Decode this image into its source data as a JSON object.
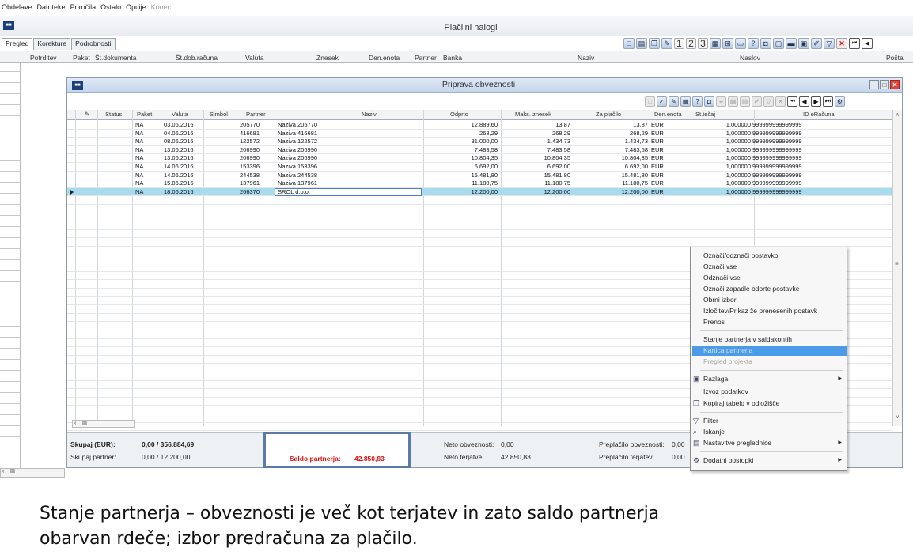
{
  "menubar": [
    "Obdelave",
    "Datoteke",
    "Poročila",
    "Ostalo",
    "Opcije",
    "Konec"
  ],
  "outer": {
    "title": "Plačilni nalogi",
    "tabs": [
      "Pregled",
      "Korekture",
      "Podrobnosti"
    ],
    "columns": [
      "Potrditev",
      "Paket",
      "Št.dokumenta",
      "Št.dob.računa",
      "Valuta",
      "Znesek",
      "Den.enota",
      "Partner",
      "Banka",
      "Naziv",
      "Naslov",
      "Pošta"
    ],
    "toolbar_numbers": [
      "1",
      "2",
      "3"
    ]
  },
  "inner": {
    "title": "Priprava obveznosti",
    "columns": [
      "Status",
      "Paket",
      "Valuta",
      "Simbol",
      "Partner",
      "Naziv",
      "Odprto",
      "Maks. znesek",
      "Za plačilo",
      "Den.enota",
      "St.tečaj",
      "ID eRačuna"
    ],
    "rows": [
      {
        "paket": "NA",
        "valuta": "03.06.2016",
        "partner": "205770",
        "naziv": "Naziva 205770",
        "odprto": "12.889,60",
        "maks": "13,87",
        "za_placilo": "13,87",
        "den": "EUR",
        "tecaj": "1,000000",
        "id": "999999999999999"
      },
      {
        "paket": "NA",
        "valuta": "04.06.2016",
        "partner": "416681",
        "naziv": "Naziva 416681",
        "odprto": "268,29",
        "maks": "268,29",
        "za_placilo": "268,29",
        "den": "EUR",
        "tecaj": "1,000000",
        "id": "999999999999999"
      },
      {
        "paket": "NA",
        "valuta": "08.06.2016",
        "partner": "122572",
        "naziv": "Naziva 122572",
        "odprto": "31.000,00",
        "maks": "1.434,73",
        "za_placilo": "1.434,73",
        "den": "EUR",
        "tecaj": "1,000000",
        "id": "999999999999999"
      },
      {
        "paket": "NA",
        "valuta": "13.06.2016",
        "partner": "206990",
        "naziv": "Naziva 206990",
        "odprto": "7.483,58",
        "maks": "7.483,58",
        "za_placilo": "7.483,58",
        "den": "EUR",
        "tecaj": "1,000000",
        "id": "999999999999999"
      },
      {
        "paket": "NA",
        "valuta": "13.06.2016",
        "partner": "206990",
        "naziv": "Naziva 206990",
        "odprto": "10.804,35",
        "maks": "10.804,35",
        "za_placilo": "10.804,35",
        "den": "EUR",
        "tecaj": "1,000000",
        "id": "999999999999999"
      },
      {
        "paket": "NA",
        "valuta": "14.06.2016",
        "partner": "153396",
        "naziv": "Naziva 153396",
        "odprto": "6.692,00",
        "maks": "6.692,00",
        "za_placilo": "6.692,00",
        "den": "EUR",
        "tecaj": "1,000000",
        "id": "999999999999999"
      },
      {
        "paket": "NA",
        "valuta": "14.06.2016",
        "partner": "244538",
        "naziv": "Naziva 244538",
        "odprto": "15.481,80",
        "maks": "15.481,80",
        "za_placilo": "15.481,80",
        "den": "EUR",
        "tecaj": "1,000000",
        "id": "999999999999999"
      },
      {
        "paket": "NA",
        "valuta": "15.06.2016",
        "partner": "137961",
        "naziv": "Naziva 137961",
        "odprto": "11.180,75",
        "maks": "11.180,75",
        "za_placilo": "11.180,75",
        "den": "EUR",
        "tecaj": "1,000000",
        "id": "999999999999999"
      },
      {
        "paket": "NA",
        "valuta": "18.06.2016",
        "partner": "266370",
        "naziv": "SROL d.o.o.",
        "odprto": "12.200,00",
        "maks": "12.200,00",
        "za_placilo": "12.200,00",
        "den": "EUR",
        "tecaj": "1,000000",
        "id": "999999999999999"
      }
    ],
    "selected_row_index": 8
  },
  "footer": {
    "skupaj_label": "Skupaj (EUR):",
    "skupaj_value": "0,00 / 356.884,69",
    "partner_label": "Skupaj partner:",
    "partner_value": "0,00 / 12.200,00",
    "saldo_label": "Saldo partnerja:",
    "saldo_value": "42.850,83",
    "neto_obv_label": "Neto obveznosti:",
    "neto_obv_value": "0,00",
    "neto_ter_label": "Neto terjatve:",
    "neto_ter_value": "42.850,83",
    "prepl_obv_label": "Preplačilo obveznosti:",
    "prepl_obv_value": "0,00",
    "prepl_ter_label": "Preplačilo terjatev:",
    "prepl_ter_value": "0,00"
  },
  "context_menu": [
    {
      "label": "Označi/odznači postavko"
    },
    {
      "label": "Označi vse"
    },
    {
      "label": "Odznači vse"
    },
    {
      "label": "Označi zapadle odprte postavke"
    },
    {
      "label": "Obrni izbor"
    },
    {
      "label": "Izločitev/Prikaz že prenesenih postavk"
    },
    {
      "label": "Prenos"
    },
    {
      "label": "Stanje partnerja v saldakontih"
    },
    {
      "label": "Kartica partnerja"
    },
    {
      "label": "Pregled projekta"
    },
    {
      "label": "Razlaga"
    },
    {
      "label": "Izvoz podatkov"
    },
    {
      "label": "Kopiraj tabelo v odložišče"
    },
    {
      "label": "Filter"
    },
    {
      "label": "Iskanje"
    },
    {
      "label": "Nastavitve preglednice"
    },
    {
      "label": "Dodatni postopki"
    }
  ],
  "caption": {
    "line1": "Stanje partnerja – obveznosti je več kot terjatev in zato saldo partnerja",
    "line2": "obarvan rdeče; izbor predračuna za plačilo."
  },
  "colors": {
    "selected_row": "#a9dbee",
    "menu_highlight": "#4c9be8",
    "saldo_red": "#dd1111",
    "frame_blue": "#5b7aa6"
  }
}
